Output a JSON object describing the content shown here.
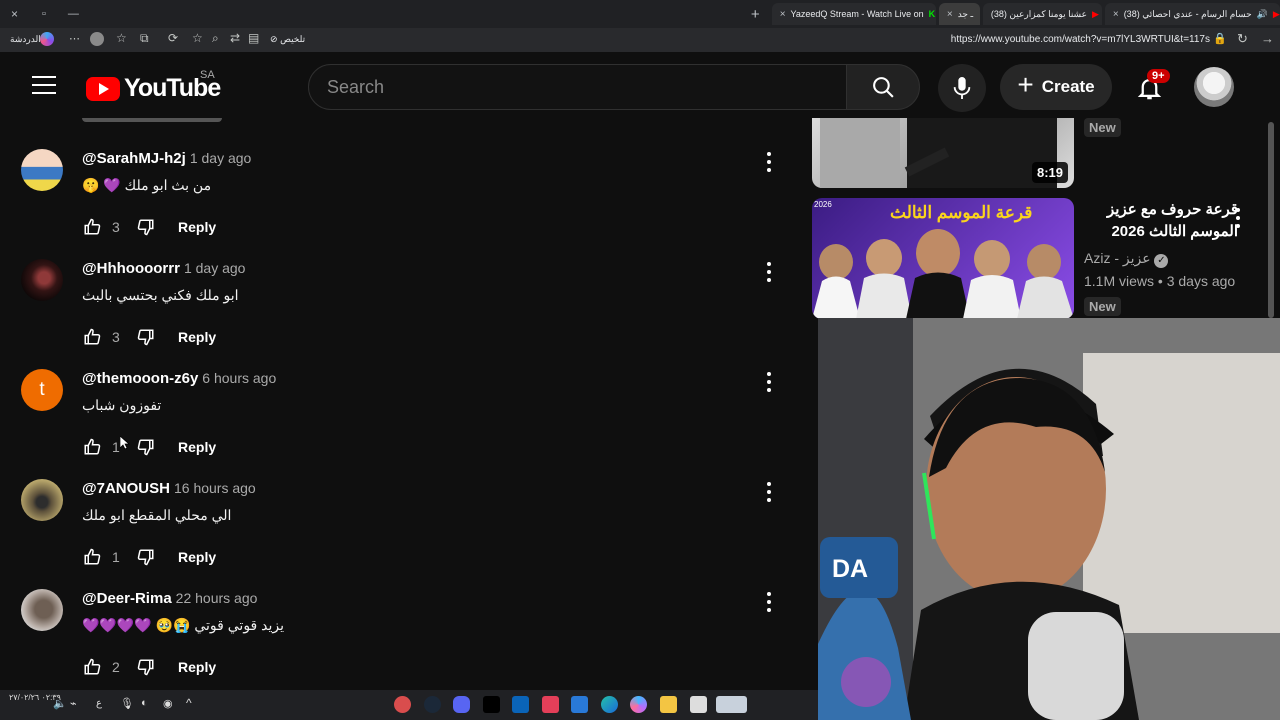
{
  "browser": {
    "tabs": [
      "(38) حسام الرسام - عندي احصائي",
      "(38) عشنا يومنا كمزارعين",
      "ـ جد",
      "YazeedQ Stream - Watch Live on"
    ],
    "url": "https://www.youtube.com/watch?v=m7lYL3WRTUI&t=117s",
    "summary_button": "تلخيص",
    "chat_label": "الدردشة"
  },
  "youtube": {
    "logo": "YouTube",
    "region": "SA",
    "search_placeholder": "Search",
    "create_label": "Create",
    "notification_count": "9+"
  },
  "comments": [
    {
      "handle": "@SarahMJ-h2j",
      "time": "1 day ago",
      "text": "من بث ابو ملك 💜 🤫",
      "likes": "3",
      "reply": "Reply",
      "avatar_color": "#2e5ea8"
    },
    {
      "handle": "@Hhhoooorrr",
      "time": "1 day ago",
      "text": "ابو ملك فكني بحتسي بالبث",
      "likes": "3",
      "reply": "Reply",
      "avatar_color": "#6c2b2b"
    },
    {
      "handle": "@themooon-z6y",
      "time": "6 hours ago",
      "text": "تفوزون شباب",
      "likes": "1",
      "reply": "Reply",
      "avatar_color": "#ef6c00"
    },
    {
      "handle": "@7ANOUSH",
      "time": "16 hours ago",
      "text": "الي محلي المقطع ابو ملك",
      "likes": "1",
      "reply": "Reply",
      "avatar_color": "#6b5d3d"
    },
    {
      "handle": "@Deer-Rima",
      "time": "22 hours ago",
      "text": "يزيد قوتي قوتي 😭🥹 💜💜💜💜",
      "likes": "2",
      "reply": "Reply",
      "avatar_color": "#7c6f68"
    }
  ],
  "sidebar": {
    "top_video": {
      "duration": "8:19",
      "badge": "New"
    },
    "video": {
      "title": "قرعة حروف مع عزيز الموسم الثالث 2026",
      "thumbnail_text": "قرعة الموسم الثالث",
      "year": "2026",
      "channel": "Aziz - عزيز",
      "stats": "1.1M views • 3 days ago",
      "badge": "New"
    }
  },
  "taskbar": {
    "clock": "٠٢:٣٩\n٢٧/٠٢/٢٦"
  }
}
